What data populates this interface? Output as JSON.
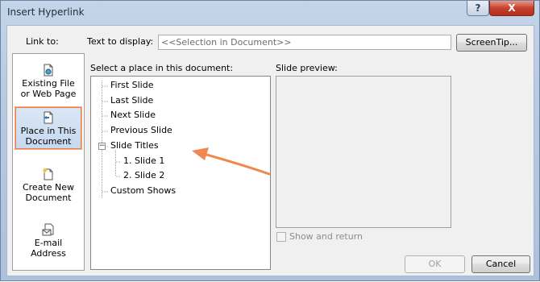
{
  "window": {
    "title": "Insert Hyperlink",
    "help_label": "?",
    "close_label": "X"
  },
  "link_to": {
    "label": "Link to:",
    "items": [
      {
        "line1": "Existing File",
        "line2": "or Web Page",
        "icon": "existing-file-icon",
        "selected": false
      },
      {
        "line1": "Place in This",
        "line2": "Document",
        "icon": "place-in-document-icon",
        "selected": true
      },
      {
        "line1": "Create New",
        "line2": "Document",
        "icon": "new-document-icon",
        "selected": false
      },
      {
        "line1": "E-mail",
        "line2": "Address",
        "icon": "email-icon",
        "selected": false
      }
    ]
  },
  "text_to_display": {
    "label": "Text to display:",
    "value": "<<Selection in Document>>"
  },
  "screentip_label": "ScreenTip...",
  "place_label": "Select a place in this document:",
  "tree": {
    "items": [
      {
        "label": "First Slide"
      },
      {
        "label": "Last Slide"
      },
      {
        "label": "Next Slide"
      },
      {
        "label": "Previous Slide"
      },
      {
        "label": "Slide Titles",
        "expanded": true,
        "expander": "−"
      },
      {
        "label": "1. Slide 1"
      },
      {
        "label": "2. Slide 2"
      },
      {
        "label": "Custom Shows"
      }
    ]
  },
  "preview_label": "Slide preview:",
  "show_return_label": "Show and return",
  "ok_label": "OK",
  "cancel_label": "Cancel",
  "annotation": {
    "color": "#f0884f"
  },
  "colors": {
    "selection_border": "#ee7a3d",
    "title_bar": "#b9cbe3",
    "close_button": "#c5412b"
  }
}
